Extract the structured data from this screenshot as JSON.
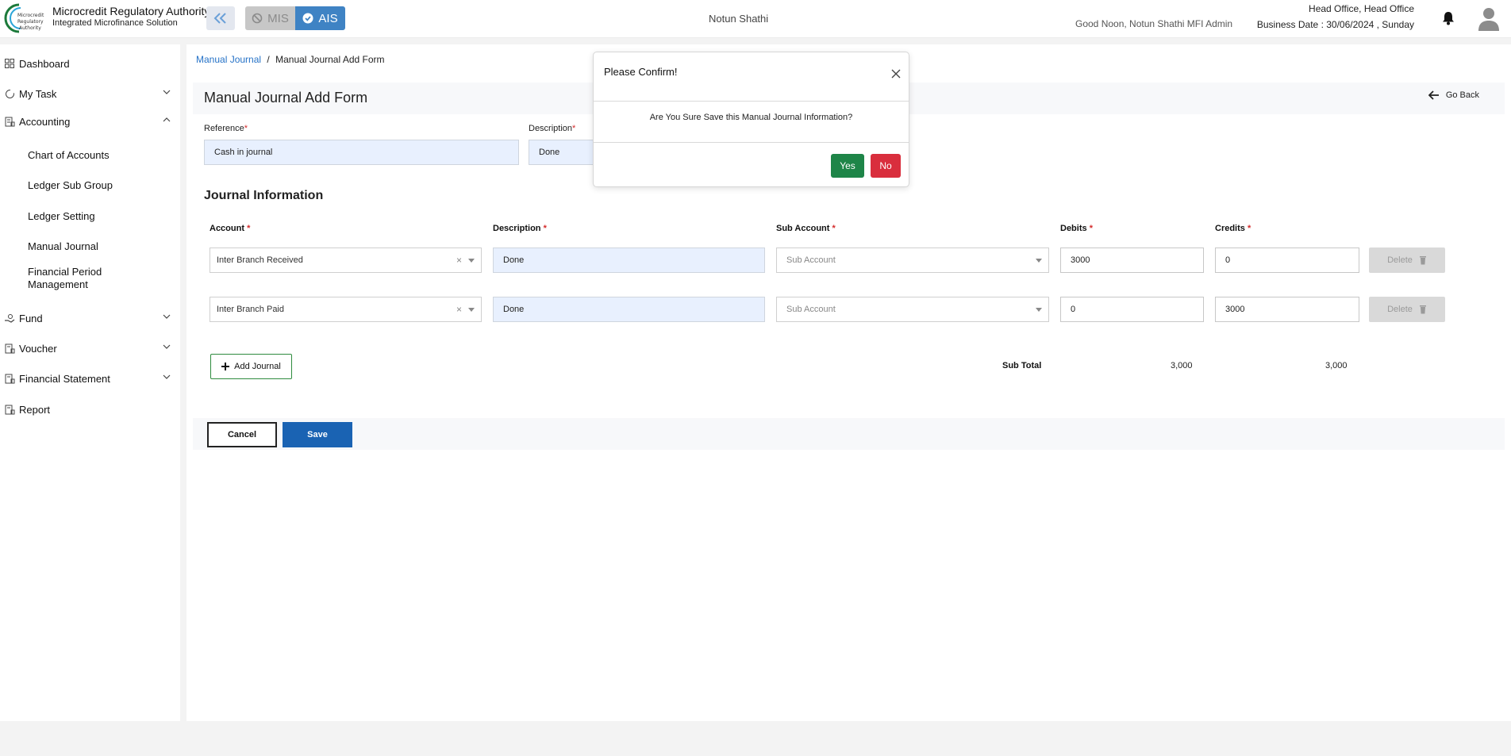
{
  "header": {
    "org_name": "Microcredit Regulatory Authority",
    "org_subtitle": "Integrated Microfinance Solution",
    "logo_text": [
      "Microcredit",
      "Regulatory",
      "Authority"
    ],
    "mode_mis": "MIS",
    "mode_ais": "AIS",
    "center_title": "Notun Shathi",
    "greeting": "Good Noon, Notun Shathi MFI Admin",
    "branch": "Head Office, Head Office",
    "business_date": "Business Date : 30/06/2024 , Sunday",
    "icons": [
      "double-chevron-left-icon",
      "ban-icon",
      "check-circle-icon",
      "bell-icon",
      "user-avatar-icon"
    ]
  },
  "sidebar": {
    "dashboard": "Dashboard",
    "my_task": "My Task",
    "accounting": "Accounting",
    "accounting_sub": {
      "chart_of_accounts": "Chart of Accounts",
      "ledger_sub_group": "Ledger Sub Group",
      "ledger_setting": "Ledger Setting",
      "manual_journal": "Manual Journal",
      "financial_period_line1": "Financial Period",
      "financial_period_line2": "Management"
    },
    "fund": "Fund",
    "voucher": "Voucher",
    "financial_statement": "Financial Statement",
    "report": "Report"
  },
  "breadcrumb": {
    "link": "Manual Journal",
    "separator": "/",
    "current": "Manual Journal Add Form"
  },
  "form": {
    "title": "Manual Journal Add Form",
    "go_back": "Go Back",
    "reference_label": "Reference",
    "reference_value": "Cash in journal",
    "description_label": "Description",
    "description_value": "Done",
    "required_mark": "*"
  },
  "journal": {
    "section_title": "Journal Information",
    "headers": {
      "account": "Account",
      "description": "Description",
      "sub_account": "Sub Account",
      "debits": "Debits",
      "credits": "Credits"
    },
    "rows": [
      {
        "account": "Inter Branch Received",
        "description": "Done",
        "sub_account_placeholder": "Sub Account",
        "debit": "3000",
        "credit": "0",
        "delete": "Delete"
      },
      {
        "account": "Inter Branch Paid",
        "description": "Done",
        "sub_account_placeholder": "Sub Account",
        "debit": "0",
        "credit": "3000",
        "delete": "Delete"
      }
    ],
    "add_journal": "Add Journal",
    "sub_total_label": "Sub Total",
    "sub_total_debit": "3,000",
    "sub_total_credit": "3,000"
  },
  "actions": {
    "cancel": "Cancel",
    "save": "Save"
  },
  "modal": {
    "title": "Please Confirm!",
    "message": "Are You Sure Save this Manual Journal Information?",
    "yes": "Yes",
    "no": "No"
  },
  "colors": {
    "primary": "#1a63b3",
    "link": "#2572c7",
    "yes": "#1e8548",
    "no": "#d92e3d",
    "ais_active": "#3f83c4"
  }
}
